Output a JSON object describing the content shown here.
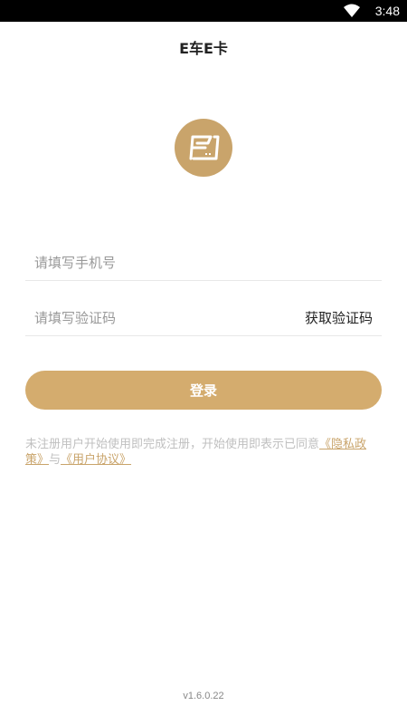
{
  "status_bar": {
    "time": "3:48",
    "wifi_icon": "wifi-icon"
  },
  "header": {
    "title": "E车E卡"
  },
  "logo": {
    "icon": "card-logo-icon",
    "color": "#c9a46b"
  },
  "form": {
    "phone_placeholder": "请填写手机号",
    "code_placeholder": "请填写验证码",
    "get_code_label": "获取验证码",
    "login_label": "登录"
  },
  "agreement": {
    "text": "未注册用户开始使用即完成注册，开始使用即表示已同意",
    "privacy_link": "《隐私政策》",
    "connector": "与",
    "user_link": "《用户协议》"
  },
  "footer": {
    "version": "v1.6.0.22"
  },
  "colors": {
    "accent": "#d4ac6e",
    "link": "#c9a46b"
  }
}
